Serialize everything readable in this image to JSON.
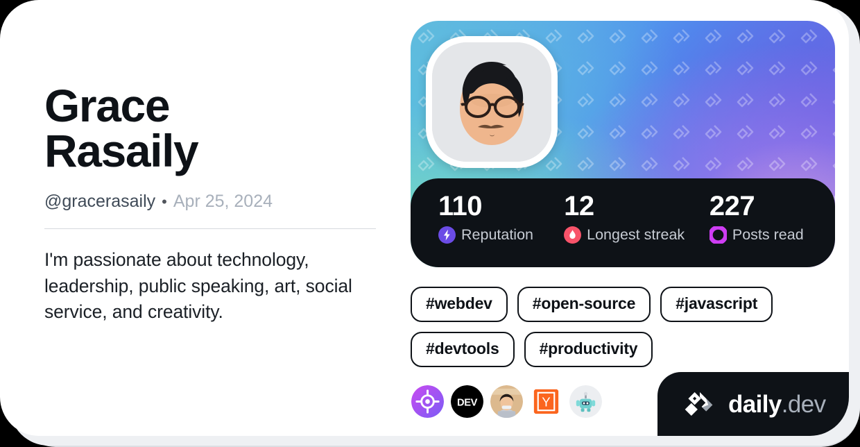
{
  "profile": {
    "display_name": "Grace\nRasaily",
    "handle": "@gracerasaily",
    "separator": "•",
    "joined_date": "Apr 25, 2024",
    "bio": "I'm passionate about technology, leadership, public speaking, art, social service, and creativity."
  },
  "stats": [
    {
      "value": "110",
      "label": "Reputation",
      "icon": "reputation-bolt-icon",
      "color": "#6B4CE6"
    },
    {
      "value": "12",
      "label": "Longest streak",
      "icon": "streak-flame-icon",
      "color": "#F8536A"
    },
    {
      "value": "227",
      "label": "Posts read",
      "icon": "posts-read-ring-icon",
      "color": "#CE3DF3"
    }
  ],
  "tags": [
    "#webdev",
    "#open-source",
    "#javascript",
    "#devtools",
    "#productivity"
  ],
  "sources": [
    {
      "name": "target-source-icon"
    },
    {
      "name": "devto-source-icon",
      "label": "DEV"
    },
    {
      "name": "person-avatar-source-icon"
    },
    {
      "name": "ycombinator-source-icon",
      "label": "Y"
    },
    {
      "name": "robot-emoji-source-icon"
    }
  ],
  "branding": {
    "logo": "daily-dev-logo-icon",
    "word_primary": "daily",
    "word_secondary": ".dev"
  },
  "theme": {
    "card_background": "#ffffff",
    "page_background": "#000000",
    "text_primary": "#0e1217",
    "text_muted": "#a8b0bb",
    "dark_panel": "#0e1217"
  }
}
